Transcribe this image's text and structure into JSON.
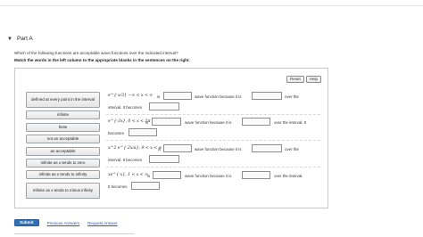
{
  "part": {
    "title": "Part A"
  },
  "question": "Which of the following functions are acceptable wave functions over the indicated interval?",
  "instructions": "Match the words in the left column to the appropriate blanks in the sentences on the right.",
  "controls": {
    "reset": "Reset",
    "help": "Help"
  },
  "word_bank": [
    "defined at every point in the interval",
    "infinite",
    "finite",
    "not an acceptable",
    "an acceptable",
    "infinite as x tends to zero",
    "infinite as x tends to infinity",
    "infinite as x tends to minus infinity"
  ],
  "sentences": [
    {
      "math": "e^{-x/3}   −∞ < x < ∞",
      "is": "is",
      "mid": "wave function because it is",
      "end": "over the",
      "line2": "interval. It becomes"
    },
    {
      "math": "e^{-3x},  0 < x < 2π",
      "is": "is",
      "mid": "wave function because it is",
      "end": "over the interval. It",
      "line2": "becomes"
    },
    {
      "math": "x^2 e^{-2x/a},  0 < x < ∞",
      "is": "is",
      "mid": "wave function because it is",
      "end": "over the",
      "line2": "interval. It becomes"
    },
    {
      "math": "xe^{-x},  1 < x < ∞",
      "is": "is",
      "mid": "wave function because it is",
      "end": "over the interval.",
      "line2": "It becomes"
    }
  ],
  "actions": {
    "submit": "Submit",
    "previous_answers": "Previous Answers",
    "request_answer": "Request Answer"
  }
}
